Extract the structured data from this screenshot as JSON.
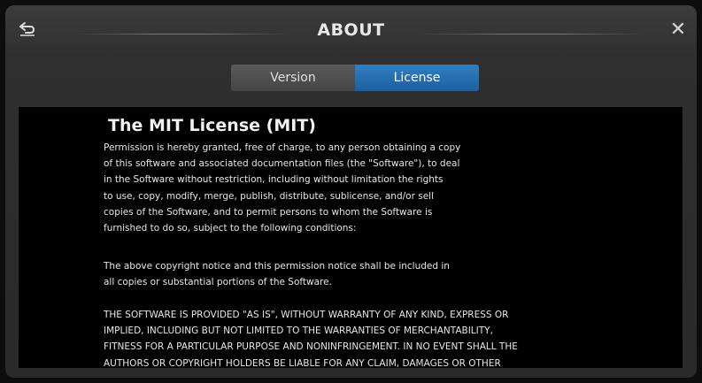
{
  "header": {
    "title": "ABOUT",
    "back_icon": "back-arrow-icon",
    "close_icon": "close-icon",
    "close_glyph": "✕"
  },
  "tabs": [
    {
      "label": "Version",
      "selected": false
    },
    {
      "label": "License",
      "selected": true
    }
  ],
  "license": {
    "heading": "The MIT License (MIT)",
    "paragraph1": [
      "Permission is hereby granted, free of charge, to any person obtaining a copy",
      "of this software and associated documentation files (the \"Software\"), to deal",
      "in the Software without restriction, including without limitation the rights",
      "to use, copy, modify, merge, publish, distribute, sublicense, and/or sell",
      "copies of the Software, and to permit persons to whom the Software is",
      "furnished to do so, subject to the following conditions:"
    ],
    "paragraph2": [
      "The above copyright notice and this permission notice shall be included in",
      "all copies or substantial portions of the Software."
    ],
    "paragraph3": [
      "THE SOFTWARE IS PROVIDED \"AS IS\", WITHOUT WARRANTY OF ANY KIND, EXPRESS OR",
      "IMPLIED, INCLUDING BUT NOT LIMITED TO THE WARRANTIES OF MERCHANTABILITY,",
      "FITNESS FOR A PARTICULAR PURPOSE AND NONINFRINGEMENT. IN NO EVENT SHALL THE",
      "AUTHORS OR COPYRIGHT HOLDERS BE LIABLE FOR ANY CLAIM, DAMAGES OR OTHER"
    ]
  },
  "colors": {
    "accent_tab": "#2f7fc4",
    "panel_background": "#000000",
    "window_background": "#2f2f2f"
  }
}
